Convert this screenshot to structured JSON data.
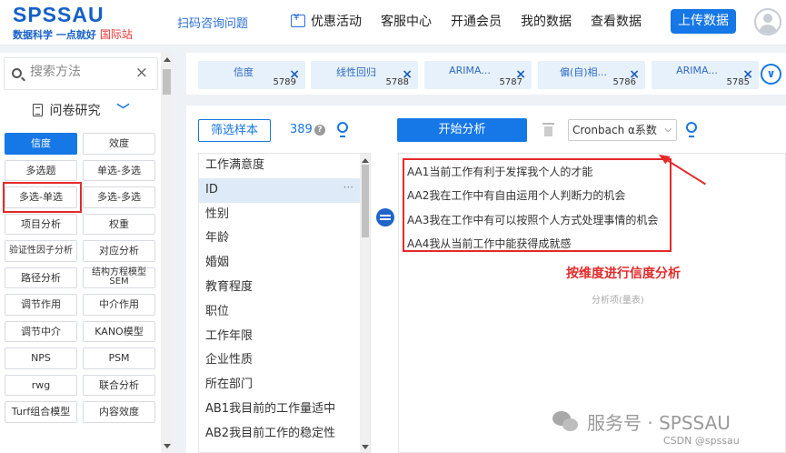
{
  "header": {
    "logo": "SPSSAU",
    "tagline": "数据科学 一点就好",
    "intl": "国际站",
    "scan": "扫码咨询问题",
    "nav": [
      "优惠活动",
      "客服中心",
      "开通会员",
      "我的数据",
      "查看数据"
    ],
    "upload": "上传数据"
  },
  "sidebar": {
    "search_placeholder": "搜索方法",
    "category": "问卷研究",
    "methods": [
      "信度",
      "效度",
      "多选题",
      "单选-多选",
      "多选-单选",
      "多选-多选",
      "项目分析",
      "权重",
      "验证性因子分析",
      "对应分析",
      "路径分析",
      "结构方程模型SEM",
      "调节作用",
      "中介作用",
      "调节中介",
      "KANO模型",
      "NPS",
      "PSM",
      "rwg",
      "联合分析",
      "Turf组合模型",
      "内容效度"
    ],
    "active": "信度"
  },
  "tabs": [
    {
      "name": "信度",
      "id": "5789"
    },
    {
      "name": "线性回归",
      "id": "5788"
    },
    {
      "name": "ARIMA...",
      "id": "5787"
    },
    {
      "name": "偏(自)相...",
      "id": "5786"
    },
    {
      "name": "ARIMA...",
      "id": "5785"
    }
  ],
  "toolbar": {
    "filter": "筛选样本",
    "count": "389",
    "start": "开始分析",
    "method": "Cronbach α系数"
  },
  "variables": [
    "工作满意度",
    "ID",
    "性别",
    "年龄",
    "婚姻",
    "教育程度",
    "职位",
    "工作年限",
    "企业性质",
    "所在部门",
    "AB1我目前的工作量适中",
    "AB2我目前工作的稳定性"
  ],
  "selected_variables": [
    "AA1当前工作有利于发挥我个人的才能",
    "AA2我在工作中有自由运用个人判断力的机会",
    "AA3我在工作中有可以按照个人方式处理事情的机会",
    "AA4我从当前工作中能获得成就感"
  ],
  "annotation": "按维度进行信度分析",
  "analysis_placeholder": "分析项(量表)",
  "watermark": "服务号 · SPSSAU",
  "credit": "CSDN @spssau"
}
